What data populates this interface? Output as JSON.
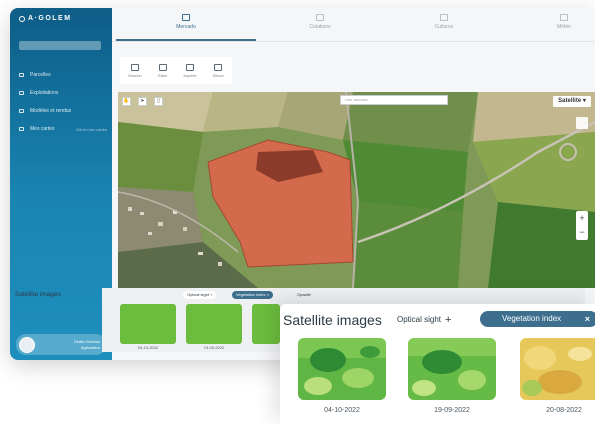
{
  "app": {
    "logo_text": "A·GOLEM"
  },
  "sidebar": {
    "items": [
      {
        "label": "Parcelles",
        "icon": "map-pin-icon",
        "extra": ""
      },
      {
        "label": "Exploitations",
        "icon": "user-icon",
        "extra": ""
      },
      {
        "label": "Modèles et rendus",
        "icon": "layers-icon",
        "extra": ""
      },
      {
        "label": "Mes cartes",
        "icon": "map-icon",
        "extra": "Gérer mes cartes"
      }
    ],
    "user": {
      "name": "Cédric Moreau",
      "role": "Agriculteur"
    }
  },
  "topnav": {
    "tabs": [
      {
        "label": "Mercado",
        "icon": "grid-icon",
        "active": true
      },
      {
        "label": "Cotations",
        "icon": "chart-icon",
        "active": false
      },
      {
        "label": "Cultures",
        "icon": "sprout-icon",
        "active": false
      },
      {
        "label": "Météo",
        "icon": "cloud-icon",
        "active": false
      }
    ]
  },
  "toolbar": {
    "tools": [
      {
        "label": "Dessiner",
        "icon": "draw-icon"
      },
      {
        "label": "Éditer",
        "icon": "edit-icon"
      },
      {
        "label": "Importer",
        "icon": "import-icon"
      },
      {
        "label": "Effacer",
        "icon": "trash-icon"
      }
    ]
  },
  "map": {
    "search_placeholder": "Une adresse",
    "basemap_label": "Satellite",
    "zoom_in": "+",
    "zoom_out": "−",
    "parcel_color": "#d9664a",
    "controls": [
      "hand-icon",
      "cursor-icon",
      "trash-icon"
    ]
  },
  "satellite_strip": {
    "title": "Satellite images",
    "optical_label": "Optical sight",
    "vegetation_label": "Vegetation index",
    "opacity_label": "Opacité",
    "mini_dates": [
      "04-10-2022",
      "19-09-2022",
      ""
    ]
  },
  "popup": {
    "title": "Satellite images",
    "optical_label": "Optical sight",
    "optical_add": "+",
    "vegetation_label": "Vegetation index",
    "vegetation_close": "×",
    "images": [
      {
        "date": "04-10-2022",
        "palette": "green"
      },
      {
        "date": "19-09-2022",
        "palette": "green"
      },
      {
        "date": "20-08-2022",
        "palette": "yellow"
      }
    ]
  },
  "colors": {
    "sidebar_top": "#0d5d87",
    "sidebar_bottom": "#1e8fbd",
    "accent": "#3d6e8e"
  }
}
